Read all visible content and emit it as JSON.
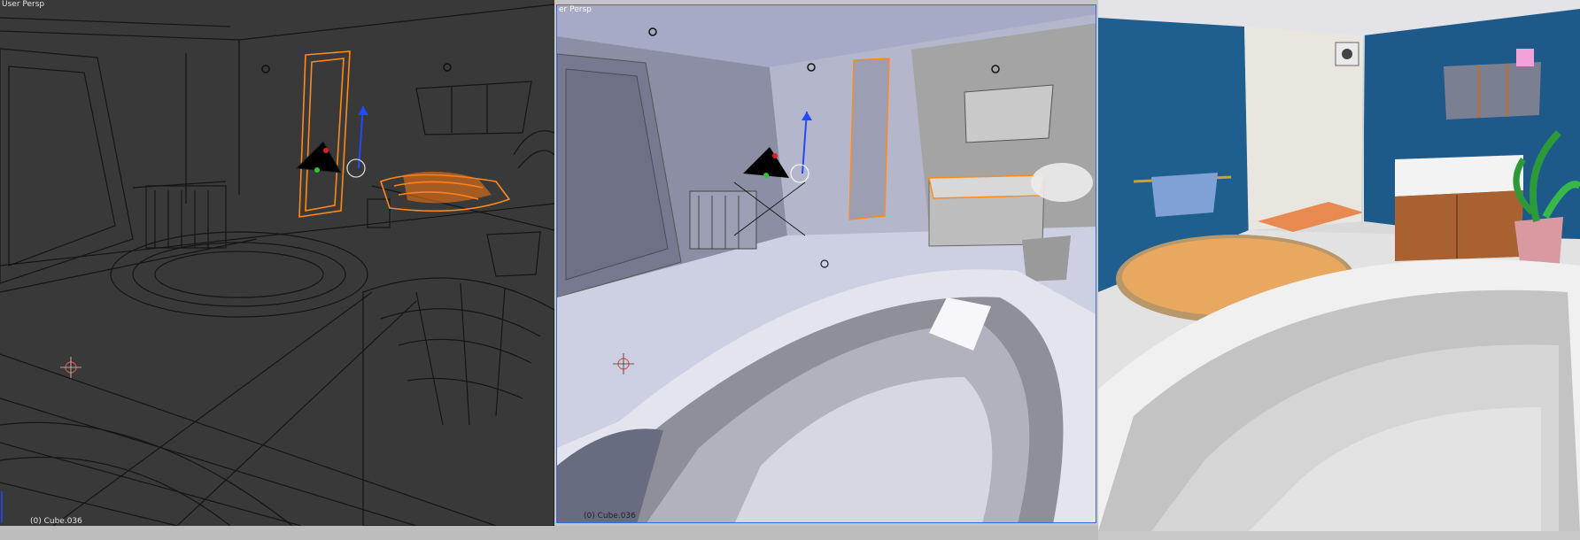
{
  "viewports": {
    "wireframe": {
      "label": "User Persp",
      "object_info": "(0) Cube.036"
    },
    "solid": {
      "label": "er Persp",
      "object_info": "(0) Cube.036"
    },
    "render": {}
  },
  "colors": {
    "wire_bg": "#393939",
    "wire_line": "#111111",
    "selected_orange": "#ff7a14",
    "solid_bg": "#c3c6dc",
    "tile_blue": "#1f5f8f",
    "rug_orange": "#e8a860",
    "active_border": "#3a6cd6"
  }
}
